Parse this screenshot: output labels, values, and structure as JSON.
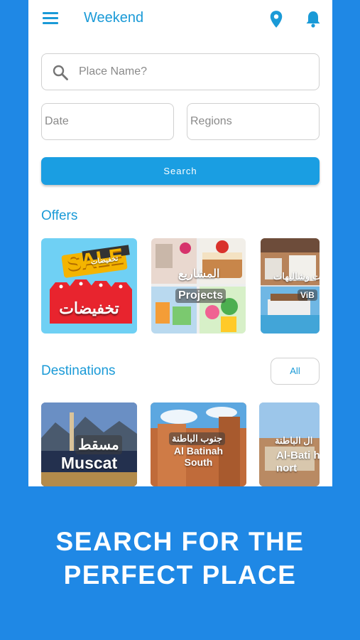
{
  "appbar": {
    "title": "Weekend"
  },
  "search": {
    "place_placeholder": "Place Name?",
    "date_placeholder": "Date",
    "regions_placeholder": "Regions",
    "button_label": "Search"
  },
  "offers": {
    "title": "Offers",
    "items": [
      {
        "label_top": "SALE",
        "label_ar": "تخفيضات",
        "label_small_ar": "تخفيضات"
      },
      {
        "label_ar": "المشاريع",
        "label": "Projects"
      },
      {
        "label_ar": "ات وشاليهات",
        "label": "ViB"
      }
    ]
  },
  "destinations": {
    "title": "Destinations",
    "all_label": "All",
    "items": [
      {
        "label_ar": "مسقط",
        "label": "Muscat"
      },
      {
        "label_ar": "جنوب الباطنة",
        "label": "Al Batinah South"
      },
      {
        "label_ar": "ال الباطنة",
        "label": "Al-Bati h nort"
      }
    ]
  },
  "promo": {
    "line1": "SEARCH FOR THE",
    "line2": "PERFECT PLACE"
  },
  "colors": {
    "background": "#1f88e5",
    "accent": "#1a9ad7",
    "button": "#1a9ee2"
  },
  "icons": [
    "menu-icon",
    "location-pin-icon",
    "bell-icon",
    "search-icon"
  ]
}
